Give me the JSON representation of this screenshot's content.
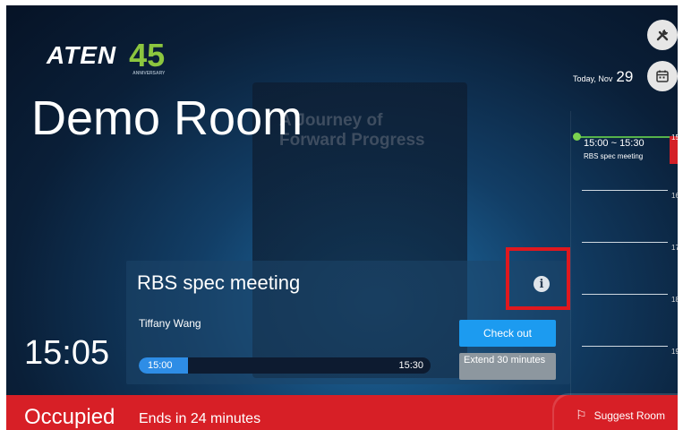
{
  "brand": {
    "name": "ATEN",
    "badge": "45",
    "badge_sub": "ANNIVERSARY"
  },
  "background_text": [
    "A Journey of",
    "Forward Progress"
  ],
  "room": {
    "name": "Demo Room",
    "clock": "15:05"
  },
  "date": {
    "prefix": "Today, Nov",
    "day": "29"
  },
  "icons": {
    "settings": "tools-icon",
    "calendar": "calendar-icon",
    "info": "info-icon",
    "suggest": "room-search-icon"
  },
  "timeline": {
    "slot_time": "15:00 ~ 15:30",
    "slot_name": "RBS spec meeting",
    "hours": [
      "15",
      "16",
      "17",
      "18",
      "19"
    ],
    "colors": {
      "now": "#56b34a",
      "busy": "#d42027"
    }
  },
  "meeting": {
    "title": "RBS spec meeting",
    "organizer": "Tiffany Wang",
    "start": "15:00",
    "end": "15:30",
    "progress": 0.17,
    "checkout_label": "Check out",
    "extend_label": "Extend 30 minutes"
  },
  "status": {
    "state": "Occupied",
    "detail": "Ends in 24 minutes",
    "color": "#d71f26",
    "suggest_label": "Suggest Room"
  }
}
